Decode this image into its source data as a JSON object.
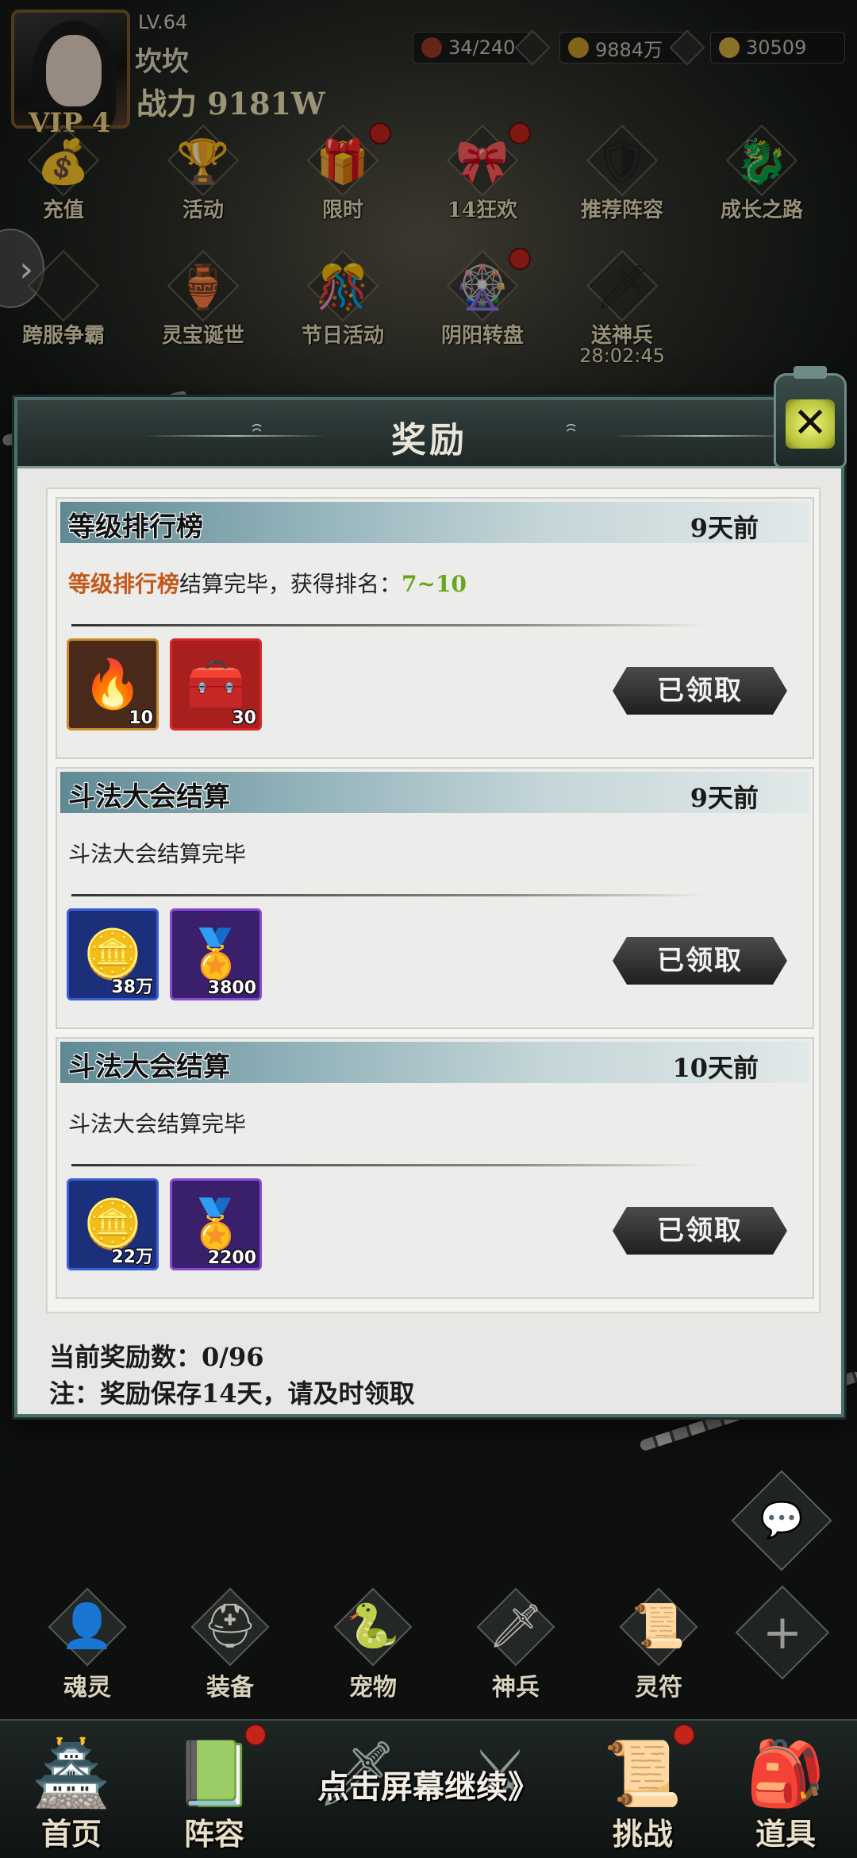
{
  "player": {
    "level": "LV.64",
    "name": "坎坎",
    "power": "战力 9181W",
    "vip": "VIP 4"
  },
  "resources": [
    {
      "icon": "stamina-icon",
      "value": "34/240",
      "color": "#9a3a2a"
    },
    {
      "icon": "coin-icon",
      "value": "9884万",
      "color": "#c89a2a"
    },
    {
      "icon": "ingot-icon",
      "value": "30509",
      "color": "#d6b040"
    }
  ],
  "top_menu_row1": [
    {
      "label": "充值",
      "icon": "gold-ingot-icon",
      "glyph": "💰",
      "dot": false
    },
    {
      "label": "活动",
      "icon": "activity-icon",
      "glyph": "🏆",
      "dot": false
    },
    {
      "label": "限时",
      "icon": "limited-icon",
      "glyph": "🎁",
      "dot": true
    },
    {
      "label": "14狂欢",
      "icon": "carnival-icon",
      "glyph": "🎀",
      "dot": true
    },
    {
      "label": "推荐阵容",
      "icon": "lineup-icon",
      "glyph": "🛡",
      "dot": false
    },
    {
      "label": "成长之路",
      "icon": "growth-icon",
      "glyph": "🐉",
      "dot": false
    }
  ],
  "top_menu_row2": [
    {
      "label": "跨服争霸",
      "icon": "crossserver-icon",
      "glyph": "⚔",
      "dot": false
    },
    {
      "label": "灵宝诞世",
      "icon": "treasure-icon",
      "glyph": "🏺",
      "dot": false
    },
    {
      "label": "节日活动",
      "icon": "festival-icon",
      "glyph": "🎊",
      "dot": false
    },
    {
      "label": "阴阳转盘",
      "icon": "wheel-icon",
      "glyph": "🎡",
      "dot": true
    },
    {
      "label": "送神兵",
      "icon": "weapon-gift-icon",
      "glyph": "🗡",
      "dot": false,
      "timer": "28:02:45"
    }
  ],
  "dialog": {
    "title": "奖励",
    "claimed_label": "已领取",
    "rewards": [
      {
        "title": "等级排行榜",
        "time": "9天前",
        "desc_highlight": "等级排行榜",
        "desc_middle": "结算完毕，获得排名：",
        "desc_rank": "7~10",
        "items": [
          {
            "icon": "fire-orb-icon",
            "glyph": "🔥",
            "qty": "10",
            "border": "#c88a2a",
            "bg": "#4a2a1a"
          },
          {
            "icon": "treasure-chest-icon",
            "glyph": "🧰",
            "qty": "30",
            "border": "#d8262a",
            "bg": "#a8201e"
          }
        ]
      },
      {
        "title": "斗法大会结算",
        "time": "9天前",
        "desc": "斗法大会结算完毕",
        "items": [
          {
            "icon": "copper-coin-icon",
            "glyph": "🪙",
            "qty": "38万",
            "border": "#3a5ed8",
            "bg": "#1c2f7a"
          },
          {
            "icon": "battle-medal-icon",
            "glyph": "🏅",
            "qty": "3800",
            "border": "#8a4ad8",
            "bg": "#3a1f6a"
          }
        ]
      },
      {
        "title": "斗法大会结算",
        "time": "10天前",
        "desc": "斗法大会结算完毕",
        "items": [
          {
            "icon": "copper-coin-icon",
            "glyph": "🪙",
            "qty": "22万",
            "border": "#3a5ed8",
            "bg": "#1c2f7a"
          },
          {
            "icon": "battle-medal-icon",
            "glyph": "🏅",
            "qty": "2200",
            "border": "#8a4ad8",
            "bg": "#3a1f6a"
          }
        ]
      }
    ],
    "count_text": "当前奖励数：0/96",
    "note_text": "注：奖励保存14天，请及时领取"
  },
  "sub_nav": [
    {
      "label": "魂灵",
      "icon": "soul-icon",
      "glyph": "👤"
    },
    {
      "label": "装备",
      "icon": "equipment-icon",
      "glyph": "⛑"
    },
    {
      "label": "宠物",
      "icon": "pet-icon",
      "glyph": "🐍"
    },
    {
      "label": "神兵",
      "icon": "divine-weapon-icon",
      "glyph": "🗡"
    },
    {
      "label": "灵符",
      "icon": "talisman-icon",
      "glyph": "📜"
    }
  ],
  "main_nav": [
    {
      "label": "首页",
      "icon": "home-icon",
      "glyph": "🏯"
    },
    {
      "label": "阵容",
      "icon": "lineup-nav-icon",
      "glyph": "📗"
    },
    {
      "label": "",
      "icon": "adventure-icon",
      "glyph": "🗡"
    },
    {
      "label": "",
      "icon": "battle-icon",
      "glyph": "⚔"
    },
    {
      "label": "挑战",
      "icon": "challenge-icon",
      "glyph": "📜"
    },
    {
      "label": "道具",
      "icon": "items-icon",
      "glyph": "🎒"
    }
  ],
  "continue_text": "点击屏幕继续》"
}
